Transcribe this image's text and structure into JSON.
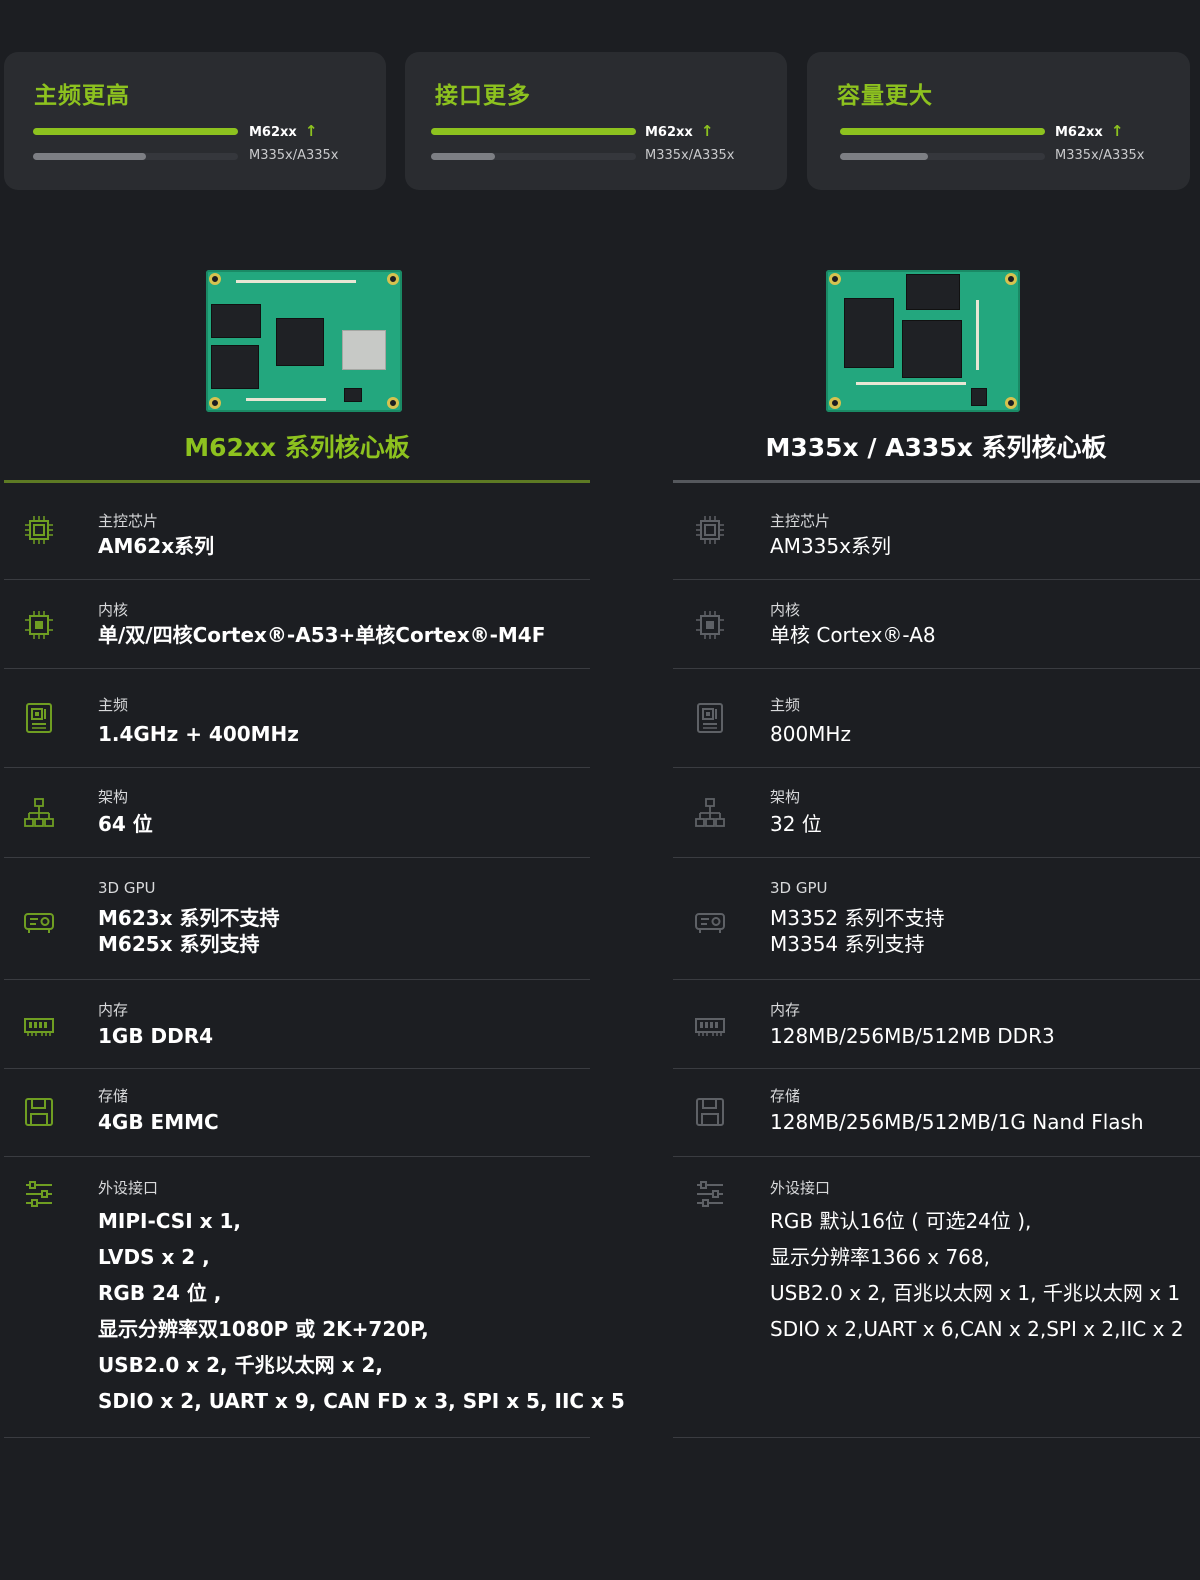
{
  "colors": {
    "accent": "#8dc21f",
    "background": "#1c1e22",
    "card": "#2a2c30"
  },
  "comparison_cards": [
    {
      "title": "主频更高",
      "new_label": "M62xx",
      "old_label": "M335x/A335x",
      "new_level": 1.0,
      "old_level": 0.55,
      "arrow_icon": "arrow-up-icon"
    },
    {
      "title": "接口更多",
      "new_label": "M62xx",
      "old_label": "M335x/A335x",
      "new_level": 1.0,
      "old_level": 0.31,
      "arrow_icon": "arrow-up-icon"
    },
    {
      "title": "容量更大",
      "new_label": "M62xx",
      "old_label": "M335x/A335x",
      "new_level": 1.0,
      "old_level": 0.43,
      "arrow_icon": "arrow-up-icon"
    }
  ],
  "products": [
    {
      "title": "M62xx 系列核心板",
      "specs": [
        {
          "icon": "cpu-icon",
          "label": "主控芯片",
          "value": "AM62x系列"
        },
        {
          "icon": "core-icon",
          "label": "内核",
          "value": "单/双/四核Cortex®-A53+单核Cortex®-M4F"
        },
        {
          "icon": "frequency-icon",
          "label": "主频",
          "value": "1.4GHz + 400MHz"
        },
        {
          "icon": "architecture-icon",
          "label": "架构",
          "value": "64 位"
        },
        {
          "icon": "gpu-icon",
          "label": "3D GPU",
          "lines": [
            "M623x 系列不支持",
            "M625x 系列支持"
          ]
        },
        {
          "icon": "memory-icon",
          "label": "内存",
          "value": "1GB DDR4"
        },
        {
          "icon": "storage-icon",
          "label": "存储",
          "value": "4GB EMMC"
        },
        {
          "icon": "sliders-icon",
          "label": "外设接口",
          "lines": [
            "MIPI-CSI x 1,",
            "LVDS x 2 ,",
            "RGB 24 位 ,",
            "显示分辨率双1080P 或 2K+720P,",
            "USB2.0 x 2, 千兆以太网 x 2,",
            "SDIO x 2, UART x 9, CAN FD x 3, SPI x 5, IIC x 5"
          ]
        }
      ]
    },
    {
      "title": "M335x / A335x 系列核心板",
      "specs": [
        {
          "icon": "cpu-icon",
          "label": "主控芯片",
          "value": "AM335x系列"
        },
        {
          "icon": "core-icon",
          "label": "内核",
          "value": "单核 Cortex®-A8"
        },
        {
          "icon": "frequency-icon",
          "label": "主频",
          "value": "800MHz"
        },
        {
          "icon": "architecture-icon",
          "label": "架构",
          "value": "32 位"
        },
        {
          "icon": "gpu-icon",
          "label": "3D GPU",
          "lines": [
            "M3352 系列不支持",
            "M3354 系列支持"
          ]
        },
        {
          "icon": "memory-icon",
          "label": "内存",
          "value": "128MB/256MB/512MB DDR3"
        },
        {
          "icon": "storage-icon",
          "label": "存储",
          "value": "128MB/256MB/512MB/1G Nand Flash"
        },
        {
          "icon": "sliders-icon",
          "label": "外设接口",
          "lines": [
            "RGB 默认16位 ( 可选24位 ),",
            "显示分辨率1366 x 768,",
            "USB2.0 x 2, 百兆以太网 x 1, 千兆以太网 x 1",
            "SDIO x 2,UART x 6,CAN x 2,SPI x 2,IIC x 2"
          ]
        }
      ]
    }
  ]
}
